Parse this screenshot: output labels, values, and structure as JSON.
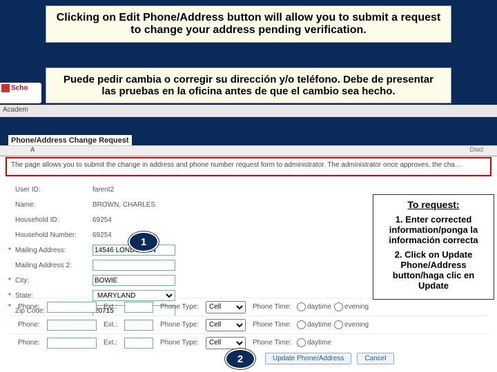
{
  "instructions": {
    "en": "Clicking on Edit Phone/Address button will allow you to submit a request to change your address pending verification.",
    "es": "Puede pedir cambia o corregir su dirección y/o teléfono. Debe de presentar las pruebas en la oficina antes de que el cambio sea hecho."
  },
  "brand_fragment": "Scho",
  "nav_word": "Academ",
  "tab_left": "A",
  "tab_right": "Discl",
  "section_title": "Phone/Address Change Request",
  "descriptor": "The page allows you to submit the change in address and phone number request form to administrator. The administrator once approves, the cha…",
  "fields": {
    "user_id": {
      "label": "User ID:",
      "value": "farent2"
    },
    "name": {
      "label": "Name:",
      "value": "BROWN, CHARLES"
    },
    "household": {
      "label": "Household ID:",
      "value": "69254"
    },
    "hh_number": {
      "label": "Household Number:",
      "value": "69254"
    },
    "mailing": {
      "label": "Mailing Address:",
      "value": "14546 LONDON LN"
    },
    "mailing2": {
      "label": "Mailing Address 2:",
      "value": ""
    },
    "city": {
      "label": "City:",
      "value": "BOWIE"
    },
    "state": {
      "label": "State:",
      "value": "MARYLAND"
    },
    "zip": {
      "label": "Zip Code:",
      "value": "20715"
    }
  },
  "phone_block": {
    "phone_label": "Phone:",
    "ext_label": "Ext.:",
    "type_label": "Phone Type:",
    "type_value": "Cell",
    "time_label": "Phone Time:",
    "daytime": "daytime",
    "evening": "evening"
  },
  "callout": {
    "title": "To request:",
    "step1": "1.  Enter corrected information/ponga la información correcta",
    "step2": "2.  Click on Update Phone/Address button/haga clic en Update"
  },
  "badges": {
    "one": "1",
    "two": "2"
  },
  "buttons": {
    "update": "Update Phone/Address",
    "cancel": "Cancel"
  }
}
